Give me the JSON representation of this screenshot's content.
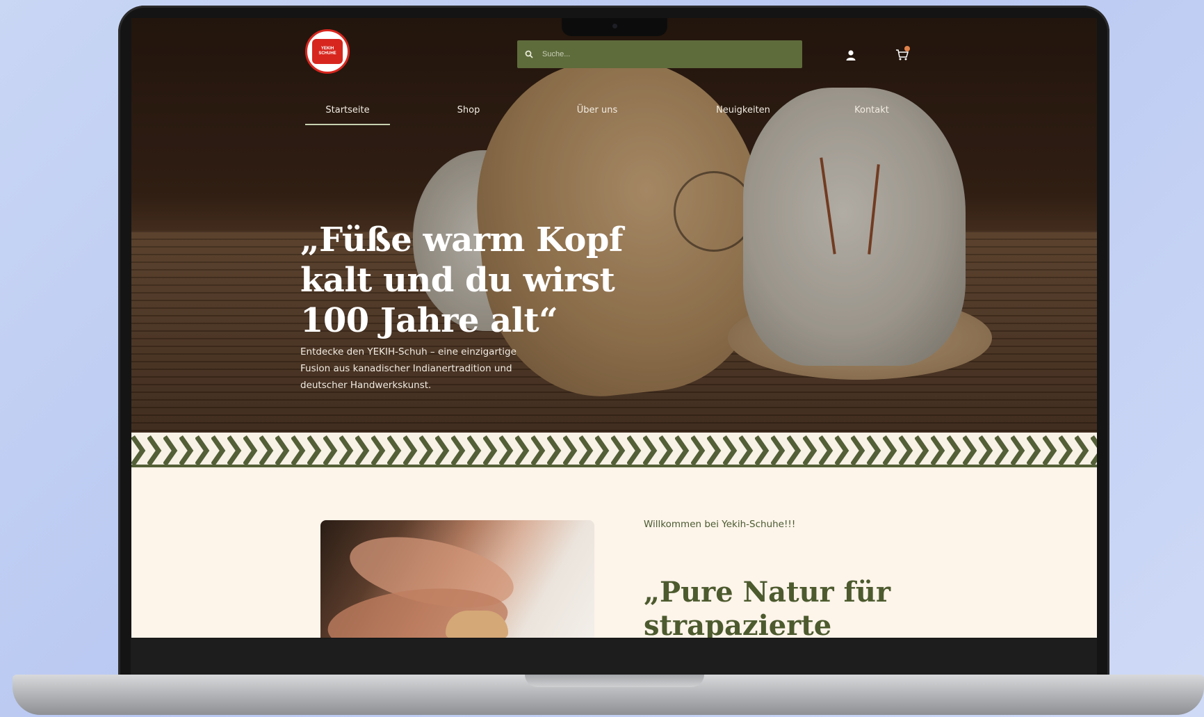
{
  "header": {
    "logo_text": "YEKIH SCHUHE",
    "search_placeholder": "Suche...",
    "user_icon": "user-icon",
    "cart_icon": "cart-icon"
  },
  "nav": {
    "items": [
      {
        "label": "Startseite",
        "active": true
      },
      {
        "label": "Shop"
      },
      {
        "label": "Über uns"
      },
      {
        "label": "Neuigkeiten"
      },
      {
        "label": "Kontakt"
      }
    ]
  },
  "hero": {
    "title": "„Füße warm Kopf kalt und du wirst 100 Jahre alt“",
    "subtitle": "Entdecke den YEKIH-Schuh – eine einzigartige Fusion aus kanadischer Indianertradition und deutscher Handwerkskunst."
  },
  "section": {
    "welcome": "Willkommen bei Yekih-Schuhe!!!",
    "title": "„Pure Natur für strapazierte"
  },
  "colors": {
    "accent_green": "#5e6b3b",
    "dark_green": "#4c5a2e",
    "cream": "#fdf4ea",
    "logo_red": "#d7261e"
  }
}
